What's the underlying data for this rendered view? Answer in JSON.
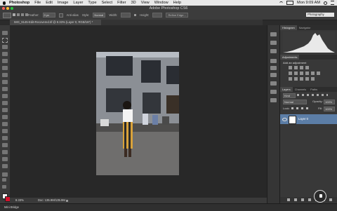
{
  "menubar": {
    "apple": "",
    "app": "Photoshop",
    "items": [
      "File",
      "Edit",
      "Image",
      "Layer",
      "Type",
      "Select",
      "Filter",
      "3D",
      "View",
      "Window",
      "Help"
    ],
    "clock": "Mon 9:09 AM"
  },
  "window_title": "Adobe Photoshop CS6",
  "options": {
    "feather_label": "Feather:",
    "feather_value": "0 px",
    "antialias": "Anti-alias",
    "style_label": "Style:",
    "style_value": "Normal",
    "width_label": "Width:",
    "height_label": "Height:",
    "refine": "Refine Edge...",
    "workspace": "Photography"
  },
  "doc_tab": "IMG_9145-Edit-Recovered.tif @ 8.33% (Layer 0, RGB/16*) *",
  "status": {
    "zoom": "8.33%",
    "doc": "Doc: 135.9M/135.9M"
  },
  "bottom": {
    "label": "Mini Bridge"
  },
  "panels": {
    "histogram_tabs": [
      "Histogram",
      "Navigator"
    ],
    "adjustments_tab": "Adjustments",
    "adjustments_hint": "Add an adjustment",
    "layers_tabs": [
      "Layers",
      "Channels",
      "Paths"
    ],
    "kind": "Kind",
    "blend": "Normal",
    "opacity_label": "Opacity:",
    "opacity_value": "100%",
    "lock_label": "Lock:",
    "fill_label": "Fill:",
    "fill_value": "100%",
    "layer_name": "Layer 0"
  },
  "colors": {
    "foreground": "#ffffff",
    "background": "#d5102b",
    "layer_selected": "#5c7ea7"
  }
}
